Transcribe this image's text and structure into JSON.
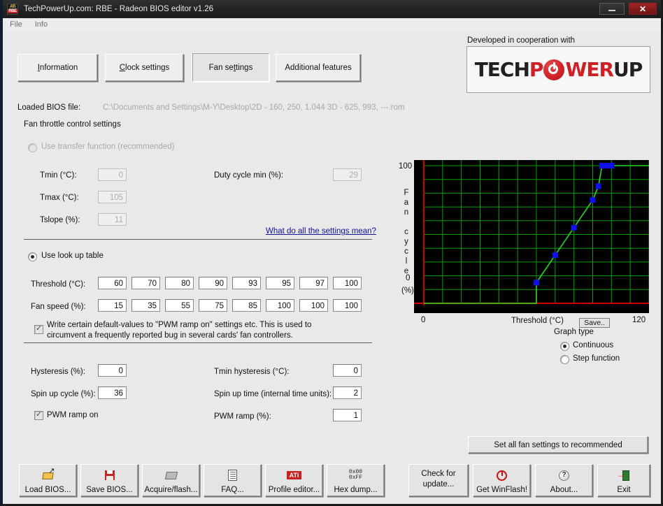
{
  "window": {
    "title": "TechPowerUp.com: RBE - Radeon BIOS editor v1.26",
    "icon_top": "ATi",
    "icon_bottom": "RBE",
    "minimize_label": "",
    "close_label": "✕"
  },
  "menu": {
    "items": [
      {
        "label": "File"
      },
      {
        "label": "Info"
      }
    ]
  },
  "tabs": [
    {
      "label": "Information",
      "accel": "I",
      "active": false
    },
    {
      "label": "Clock settings",
      "accel": "C",
      "active": false
    },
    {
      "label": "Fan settings",
      "accel": "t",
      "active": true
    },
    {
      "label": "Additional features",
      "accel": "",
      "active": false
    }
  ],
  "bios": {
    "label": "Loaded BIOS file:",
    "path": "C:\\Documents and Settings\\M-Y\\Desktop\\2D - 160, 250, 1.044 3D - 625, 993, ---.rom"
  },
  "section": {
    "fan_throttle_title": "Fan throttle control settings"
  },
  "transfer": {
    "radio_label": "Use transfer function (recommended)",
    "selected": false,
    "tmin_label": "Tmin (°C):",
    "tmin_value": "0",
    "tmax_label": "Tmax (°C):",
    "tmax_value": "105",
    "tslope_label": "Tslope (%):",
    "tslope_value": "11",
    "duty_label": "Duty cycle min (%):",
    "duty_value": "29",
    "help_link": "What do all the settings mean?"
  },
  "lookup": {
    "radio_label": "Use look up table",
    "selected": true,
    "threshold_label": "Threshold (°C):",
    "fanspeed_label": "Fan speed (%):",
    "thresholds": [
      "60",
      "70",
      "80",
      "90",
      "93",
      "95",
      "97",
      "100"
    ],
    "fanspeeds": [
      "15",
      "35",
      "55",
      "75",
      "85",
      "100",
      "100",
      "100"
    ],
    "pwm_default_checkbox": {
      "checked": true,
      "line1": "Write certain default-values to \"PWM ramp on\" settings etc. This is used to",
      "line2": "circumvent a frequently reported bug in several cards' fan controllers."
    }
  },
  "misc": {
    "hysteresis_label": "Hysteresis (%):",
    "hysteresis_value": "0",
    "spinup_cycle_label": "Spin up cycle (%):",
    "spinup_cycle_value": "36",
    "pwm_ramp_on_label": "PWM ramp on",
    "pwm_ramp_on_checked": true,
    "tmin_hyst_label": "Tmin hysteresis (°C):",
    "tmin_hyst_value": "0",
    "spinup_time_label": "Spin up time (internal time units):",
    "spinup_time_value": "2",
    "pwm_ramp_label": "PWM ramp (%):",
    "pwm_ramp_value": "1"
  },
  "tpu": {
    "caption": "Developed in cooperation with",
    "logo_part1": "TECH",
    "logo_part2": "P",
    "logo_part3": "WER",
    "logo_part4": "UP",
    "black_hex": "#231f20",
    "red_hex": "#cf2026"
  },
  "graph": {
    "save_button": "Save..",
    "type_title": "Graph type",
    "type_options": [
      {
        "label": "Continuous",
        "selected": true
      },
      {
        "label": "Step function",
        "selected": false
      }
    ]
  },
  "chart_data": {
    "type": "line",
    "title": "",
    "xlabel": "Threshold (°C)",
    "ylabel": "Fan cycle (%)",
    "ylabel_chars": [
      "F",
      "a",
      "n",
      "",
      "c",
      "y",
      "c",
      "l",
      "e",
      "",
      "(%)"
    ],
    "xlim": [
      0,
      120
    ],
    "ylim": [
      0,
      100
    ],
    "xticks": [
      0,
      120
    ],
    "yticks": [
      0,
      100
    ],
    "xtick_labels": [
      "0",
      "120"
    ],
    "ytick_labels": [
      "0",
      "100"
    ],
    "grid": true,
    "grid_color": "#00a000",
    "axis_color": "#d00000",
    "line_color": "#22dd22",
    "marker_color": "#1010ee",
    "background": "#000000",
    "x": [
      60,
      70,
      80,
      90,
      93,
      95,
      97,
      100
    ],
    "y": [
      15,
      35,
      55,
      75,
      85,
      100,
      100,
      100
    ],
    "baseline_from": 0,
    "baseline_to": 60,
    "baseline_y": 0,
    "tail_from": 100,
    "tail_to": 120,
    "tail_y": 100,
    "legend": []
  },
  "recommend": {
    "label": "Set all fan settings to recommended"
  },
  "bottom_buttons": [
    {
      "label": "Load BIOS...",
      "icon": "open-folder-icon"
    },
    {
      "label": "Save BIOS...",
      "icon": "floppy-disk-icon"
    },
    {
      "label": "Acquire/flash...",
      "icon": "chip-icon"
    },
    {
      "label": "FAQ...",
      "icon": "document-icon"
    },
    {
      "label": "Profile editor...",
      "icon": "ati-logo-icon"
    },
    {
      "label": "Hex dump...",
      "icon": "hex-icon",
      "icon_line1": "0x00",
      "icon_line2": "0xFF"
    }
  ],
  "right_buttons": [
    {
      "label_line1": "Check for",
      "label_line2": "update...",
      "icon": ""
    },
    {
      "label": "Get WinFlash!",
      "icon": "power-icon"
    },
    {
      "label": "About...",
      "icon": "question-mark-icon"
    },
    {
      "label": "Exit",
      "icon": "exit-door-icon"
    }
  ]
}
